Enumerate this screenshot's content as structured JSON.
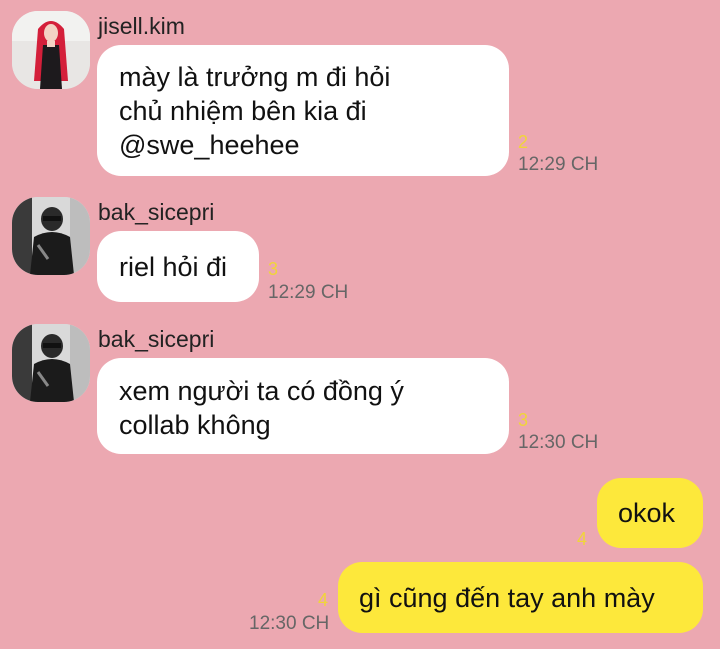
{
  "colors": {
    "background": "#eca8b1",
    "incoming_bubble": "#ffffff",
    "outgoing_bubble": "#fde83b",
    "unread_count": "#f0d53a",
    "timestamp": "#666666"
  },
  "messages": [
    {
      "sender": "jisell.kim",
      "avatar_icon": "avatar-red-hair",
      "lines": [
        "mày là trưởng m đi hỏi",
        "chủ nhiệm bên kia đi",
        "@swe_heehee"
      ],
      "unread": "2",
      "time": "12:29 CH"
    },
    {
      "sender": "bak_sicepri",
      "avatar_icon": "avatar-black-and-white",
      "lines": [
        "riel hỏi đi"
      ],
      "unread": "3",
      "time": "12:29 CH"
    },
    {
      "sender": "bak_sicepri",
      "avatar_icon": "avatar-black-and-white",
      "lines": [
        "xem người ta có đồng ý",
        "collab không"
      ],
      "unread": "3",
      "time": "12:30 CH"
    },
    {
      "lines": [
        "okok"
      ],
      "unread": "4"
    },
    {
      "lines": [
        "gì cũng đến tay anh mày"
      ],
      "unread": "4",
      "time": "12:30 CH"
    }
  ]
}
